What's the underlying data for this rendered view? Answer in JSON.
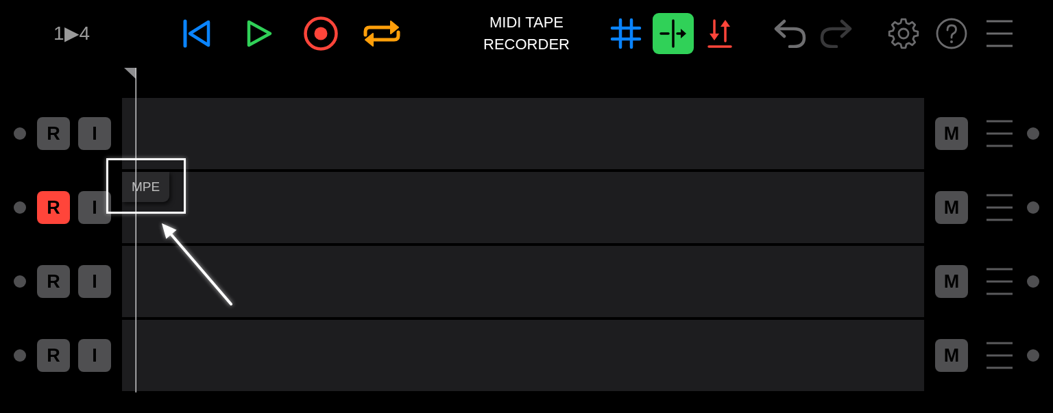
{
  "transport": {
    "counter": "1▶4"
  },
  "title": "MIDI TAPE RECORDER",
  "tools": [
    {
      "kind": "grid",
      "on": false
    },
    {
      "kind": "split",
      "on": true
    },
    {
      "kind": "shift",
      "on": false
    }
  ],
  "history": [
    {
      "kind": "undo",
      "disabled": false
    },
    {
      "kind": "redo",
      "disabled": true
    }
  ],
  "tracks": [
    {
      "record_label": "R",
      "input_label": "I",
      "mute_label": "M",
      "armed": false,
      "monitoring": false,
      "muted": false
    },
    {
      "record_label": "R",
      "input_label": "I",
      "mute_label": "M",
      "armed": true,
      "monitoring": false,
      "muted": false,
      "tag": "MPE"
    },
    {
      "record_label": "R",
      "input_label": "I",
      "mute_label": "M",
      "armed": false,
      "monitoring": false,
      "muted": false
    },
    {
      "record_label": "R",
      "input_label": "I",
      "mute_label": "M",
      "armed": false,
      "monitoring": false,
      "muted": false
    }
  ]
}
